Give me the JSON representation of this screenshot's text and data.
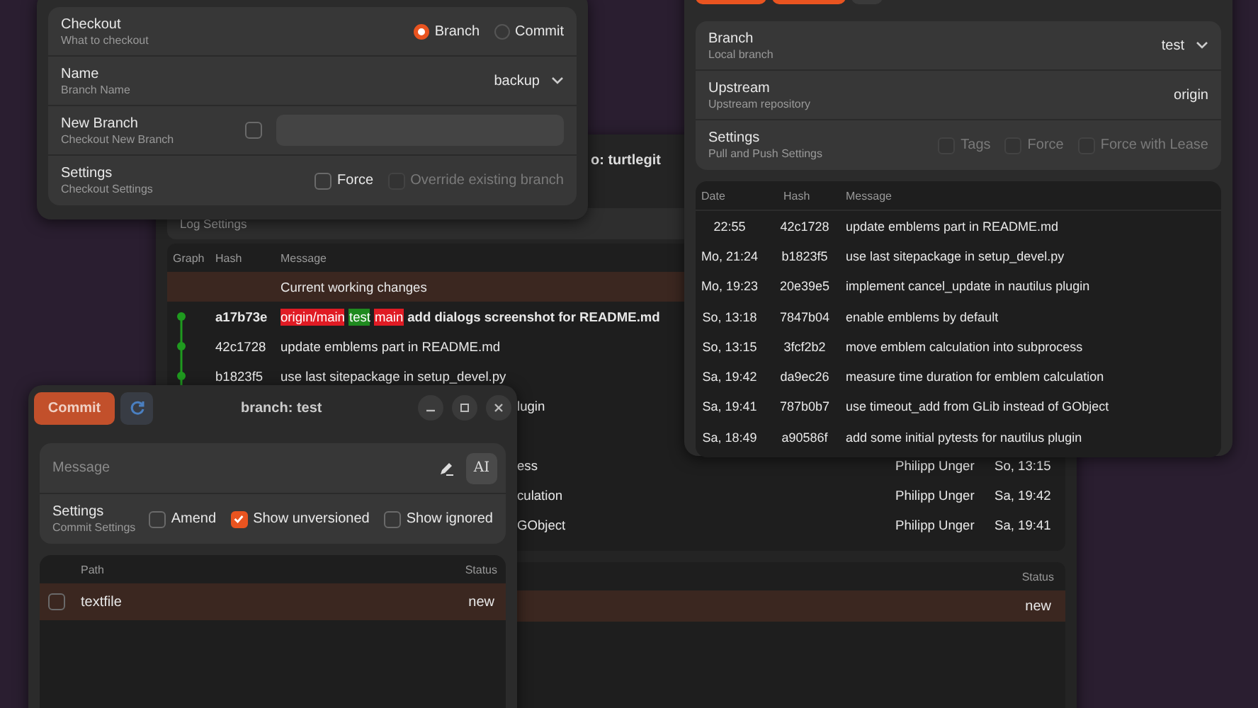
{
  "log_window": {
    "title": "o: turtlegit",
    "log_settings": "Log Settings",
    "columns": [
      "Graph",
      "Hash",
      "Message"
    ],
    "rows": [
      {
        "kind": "working",
        "message": "Current working changes",
        "selected": true
      },
      {
        "kind": "commit",
        "hash": "a17b73e",
        "head": true,
        "tags": [
          {
            "label": "origin/main",
            "color": "#e01b24"
          },
          {
            "label": "test",
            "color": "#1f8a1f"
          },
          {
            "label": "main",
            "color": "#e01b24"
          }
        ],
        "message": "add dialogs screenshot for README.md",
        "selected": false
      },
      {
        "kind": "commit",
        "hash": "42c1728",
        "head": false,
        "message": "update emblems part in README.md",
        "selected": false
      },
      {
        "kind": "commit",
        "hash": "b1823f5",
        "head": false,
        "message": "use last sitepackage in setup_devel.py",
        "selected": false
      },
      {
        "kind": "partial",
        "message": "lugin",
        "selected": false
      },
      {
        "kind": "partial",
        "message": "ess",
        "author": "Philipp Unger",
        "date": "So, 13:15",
        "selected": false
      },
      {
        "kind": "partial",
        "message": "culation",
        "author": "Philipp Unger",
        "date": "Sa, 19:42",
        "selected": false
      },
      {
        "kind": "partial",
        "message": "GObject",
        "author": "Philipp Unger",
        "date": "Sa, 19:41",
        "selected": false
      }
    ],
    "files_column": "Status",
    "files": [
      {
        "status": "new",
        "selected": true
      }
    ]
  },
  "checkout_window": {
    "rows": [
      {
        "kind": "radio",
        "title": "Checkout",
        "subtitle": "What to checkout",
        "options": [
          {
            "label": "Branch",
            "selected": true
          },
          {
            "label": "Commit",
            "selected": false
          }
        ]
      },
      {
        "kind": "dropdown",
        "title": "Name",
        "subtitle": "Branch Name",
        "value": "backup"
      },
      {
        "kind": "entry",
        "title": "New Branch",
        "subtitle": "Checkout New Branch",
        "checked": false
      },
      {
        "kind": "checks",
        "title": "Settings",
        "subtitle": "Checkout Settings",
        "options": [
          {
            "label": "Force",
            "checked": false,
            "disabled": false
          },
          {
            "label": "Override existing branch",
            "checked": false,
            "disabled": true
          }
        ]
      }
    ]
  },
  "push_window": {
    "rows": [
      {
        "kind": "dropdown",
        "title": "Branch",
        "subtitle": "Local branch",
        "value": "test"
      },
      {
        "kind": "value",
        "title": "Upstream",
        "subtitle": "Upstream repository",
        "value": "origin"
      },
      {
        "kind": "checks",
        "title": "Settings",
        "subtitle": "Pull and Push Settings",
        "options": [
          {
            "label": "Tags",
            "checked": false,
            "disabled": true
          },
          {
            "label": "Force",
            "checked": false,
            "disabled": true
          },
          {
            "label": "Force with Lease",
            "checked": false,
            "disabled": true
          }
        ]
      }
    ],
    "columns": [
      "Date",
      "Hash",
      "Message"
    ],
    "commits": [
      {
        "date": "22:55",
        "hash": "42c1728",
        "message": "update emblems part in README.md"
      },
      {
        "date": "Mo, 21:24",
        "hash": "b1823f5",
        "message": "use last sitepackage in setup_devel.py"
      },
      {
        "date": "Mo, 19:23",
        "hash": "20e39e5",
        "message": "implement cancel_update in nautilus plugin"
      },
      {
        "date": "So, 13:18",
        "hash": "7847b04",
        "message": "enable emblems by default"
      },
      {
        "date": "So, 13:15",
        "hash": "3fcf2b2",
        "message": "move emblem calculation into subprocess"
      },
      {
        "date": "Sa, 19:42",
        "hash": "da9ec26",
        "message": "measure time duration for emblem calculation"
      },
      {
        "date": "Sa, 19:41",
        "hash": "787b0b7",
        "message": "use timeout_add from GLib instead of GObject"
      },
      {
        "date": "Sa, 18:49",
        "hash": "a90586f",
        "message": "add some initial pytests for nautilus plugin"
      }
    ]
  },
  "commit_window": {
    "button": "Commit",
    "title": "branch: test",
    "message_placeholder": "Message",
    "ai_button": "AI",
    "settings": {
      "title": "Settings",
      "subtitle": "Commit Settings",
      "options": [
        {
          "label": "Amend",
          "checked": false
        },
        {
          "label": "Show unversioned",
          "checked": true
        },
        {
          "label": "Show ignored",
          "checked": false
        }
      ]
    },
    "columns": [
      "Path",
      "Status"
    ],
    "files": [
      {
        "path": "textfile",
        "status": "new",
        "checked": false,
        "selected": true
      }
    ]
  }
}
